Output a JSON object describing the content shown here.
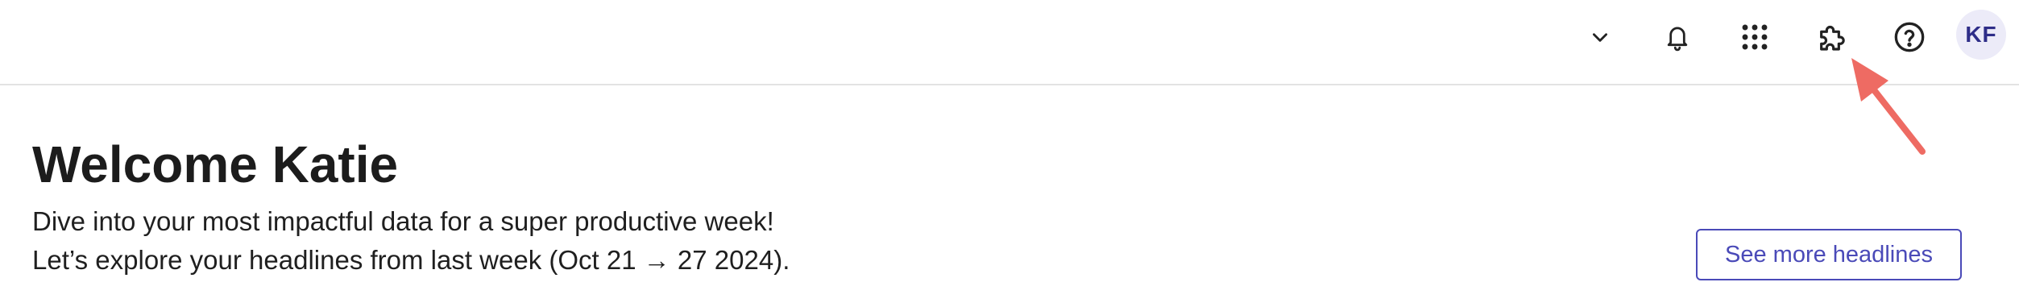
{
  "header": {
    "icons": [
      {
        "name": "chevron-down-icon"
      },
      {
        "name": "bell-icon"
      },
      {
        "name": "apps-grid-icon"
      },
      {
        "name": "puzzle-icon"
      },
      {
        "name": "help-icon"
      }
    ],
    "avatar_initials": "KF"
  },
  "welcome": {
    "title": "Welcome Katie",
    "line1": "Dive into your most impactful data for a super productive week!",
    "line2": "Let’s explore your headlines from last week (Oct 21 → 27 2024)."
  },
  "actions": {
    "see_more_label": "See more headlines"
  },
  "colors": {
    "accent": "#4a4ab8",
    "avatar_bg": "#ecebf8",
    "avatar_text": "#2e2d88",
    "annotation_arrow": "#ee6b63",
    "divider": "#e3e3e3"
  }
}
